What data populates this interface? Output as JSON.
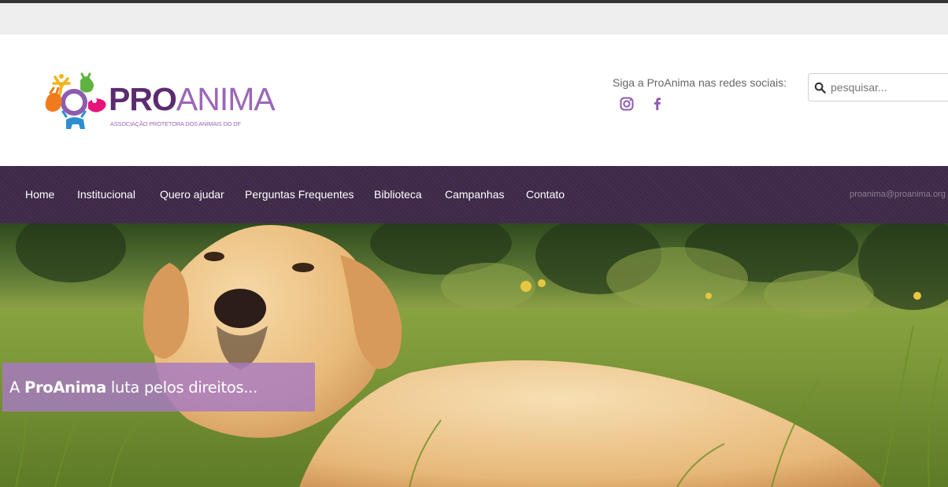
{
  "header": {
    "brand_pro": "PRO",
    "brand_anima": "ANIMA",
    "brand_subtitle": "ASSOCIAÇÃO PROTETORA DOS ANIMAIS DO DF",
    "social_label": "Siga a ProAnima nas redes sociais:",
    "social_icons": [
      "instagram-icon",
      "facebook-icon"
    ],
    "search_placeholder": "pesquisar..."
  },
  "nav": {
    "items": [
      {
        "label": "Home"
      },
      {
        "label": "Institucional"
      },
      {
        "label": "Quero ajudar"
      },
      {
        "label": "Perguntas Frequentes"
      },
      {
        "label": "Biblioteca"
      },
      {
        "label": "Campanhas"
      },
      {
        "label": "Contato"
      }
    ],
    "email": "proanima@proanima.org"
  },
  "hero": {
    "caption_prefix": "A ",
    "caption_bold": "ProAnima",
    "caption_suffix": " luta pelos direitos..."
  },
  "colors": {
    "brand_dark_purple": "#5b2c6f",
    "brand_light_purple": "#9b66b8",
    "nav_background": "#3f2a4a",
    "caption_background": "#a77ac2"
  }
}
